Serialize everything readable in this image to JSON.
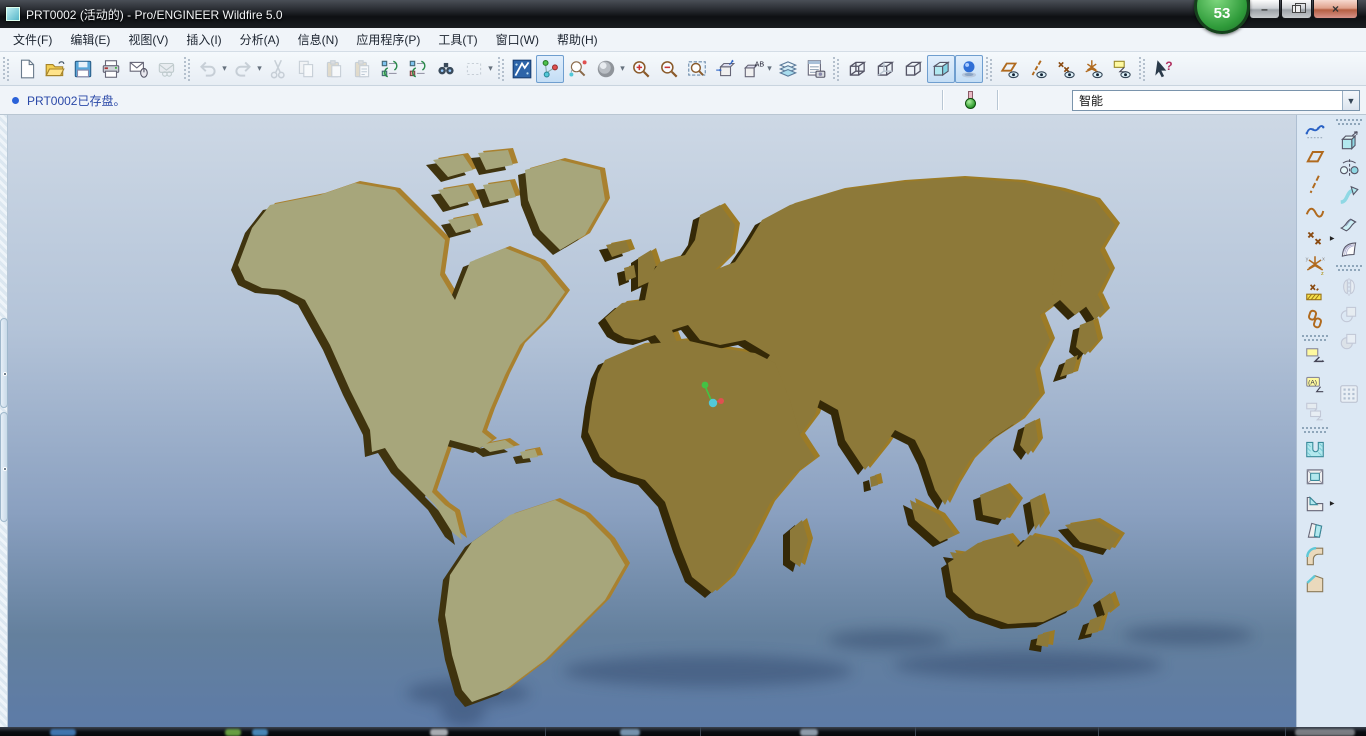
{
  "window": {
    "title": "PRT0002 (活动的) - Pro/ENGINEER Wildfire 5.0",
    "badge": "53",
    "minimize_glyph": "–",
    "close_glyph": "×"
  },
  "menu_bar": {
    "items": [
      "文件(F)",
      "编辑(E)",
      "视图(V)",
      "插入(I)",
      "分析(A)",
      "信息(N)",
      "应用程序(P)",
      "工具(T)",
      "窗口(W)",
      "帮助(H)"
    ]
  },
  "toolbar": {
    "groups": [
      {
        "buttons": [
          {
            "name": "new-file"
          },
          {
            "name": "open-folder"
          },
          {
            "name": "save"
          },
          {
            "name": "print"
          },
          {
            "name": "send-email"
          },
          {
            "name": "mail-link",
            "disabled": true
          }
        ]
      },
      {
        "buttons": [
          {
            "name": "undo",
            "disabled": true,
            "dropdown": true
          },
          {
            "name": "redo",
            "disabled": true,
            "dropdown": true
          },
          {
            "name": "cut",
            "disabled": true
          },
          {
            "name": "copy",
            "disabled": true
          },
          {
            "name": "paste",
            "disabled": true
          },
          {
            "name": "paste-special",
            "disabled": true
          },
          {
            "name": "regenerate"
          },
          {
            "name": "custom-regenerate"
          },
          {
            "name": "find"
          },
          {
            "name": "select-box",
            "disabled": true,
            "dropdown": true
          }
        ]
      },
      {
        "buttons": [
          {
            "name": "redraw"
          },
          {
            "name": "spin-center",
            "active": true
          },
          {
            "name": "orient-mode"
          },
          {
            "name": "shade-sphere",
            "dropdown": true
          },
          {
            "name": "zoom-in"
          },
          {
            "name": "zoom-out"
          },
          {
            "name": "refit"
          },
          {
            "name": "reorient"
          },
          {
            "name": "saved-views",
            "dropdown": true
          },
          {
            "name": "layers"
          },
          {
            "name": "view-manager"
          }
        ]
      },
      {
        "buttons": [
          {
            "name": "wireframe"
          },
          {
            "name": "hidden-line"
          },
          {
            "name": "no-hidden"
          },
          {
            "name": "shaded",
            "active": true
          },
          {
            "name": "enhanced-realism",
            "active": true
          }
        ]
      },
      {
        "buttons": [
          {
            "name": "datum-planes-display"
          },
          {
            "name": "datum-axes-display"
          },
          {
            "name": "datum-points-display"
          },
          {
            "name": "csys-display"
          },
          {
            "name": "annotations-display"
          }
        ]
      },
      {
        "buttons": [
          {
            "name": "context-help"
          }
        ]
      }
    ]
  },
  "message_bar": {
    "message": "PRT0002已存盘。",
    "filter_value": "智能"
  },
  "right_toolbar": {
    "left_column": [
      {
        "name": "sketch-tool"
      },
      {
        "name": "datum-plane-tool"
      },
      {
        "name": "datum-axis-tool"
      },
      {
        "name": "datum-curve-tool"
      },
      {
        "name": "datum-point-tool",
        "flyout": true
      },
      {
        "name": "csys-tool"
      },
      {
        "name": "sketched-datum-tool"
      },
      {
        "name": "copy-geometry-tool"
      },
      {
        "sep": true
      },
      {
        "name": "annotation-tool"
      },
      {
        "name": "annotation-text-tool"
      },
      {
        "name": "annotation-declutter-tool",
        "disabled": true
      },
      {
        "sep": true
      },
      {
        "name": "hole-tool"
      },
      {
        "name": "shell-tool"
      },
      {
        "name": "rib-tool",
        "flyout": true
      },
      {
        "name": "draft-tool"
      },
      {
        "name": "round-tool"
      },
      {
        "name": "chamfer-tool"
      }
    ],
    "right_column": [
      {
        "sep": true
      },
      {
        "name": "extrude-tool"
      },
      {
        "name": "revolve-tool"
      },
      {
        "name": "sweep-tool"
      },
      {
        "name": "swept-blend-tool"
      },
      {
        "name": "boundary-blend-tool"
      },
      {
        "sep": true
      },
      {
        "name": "mirror-tool",
        "disabled": true
      },
      {
        "name": "trim-tool",
        "disabled": true
      },
      {
        "name": "merge-tool",
        "disabled": true
      },
      {
        "gap": true
      },
      {
        "name": "pattern-tool",
        "disabled": true
      }
    ]
  },
  "viewport": {
    "colors": {
      "sky_top": "#cdd8e5",
      "sky_bottom": "#5d7ba7",
      "land_west": "#a7a67b",
      "land_east": "#8d7939",
      "extrude_dark_west": "#40340f",
      "extrude_dark_east": "#352907",
      "extrude_gold": "#a9812f",
      "reflection": "#2e4569",
      "spin_center_green": "#44c244",
      "spin_center_red": "#e05050",
      "spin_center_cyan": "#52c8d8"
    }
  }
}
